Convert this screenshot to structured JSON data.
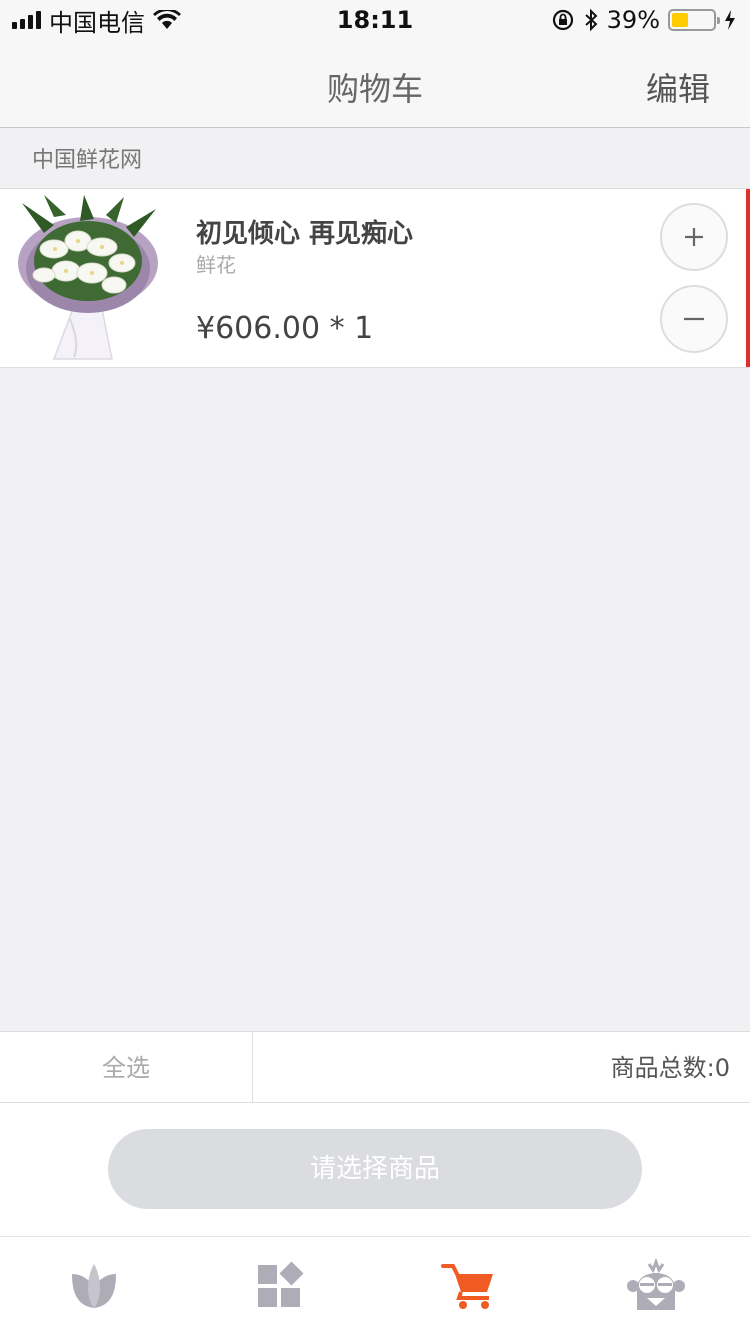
{
  "status_bar": {
    "carrier": "中国电信",
    "time": "18:11",
    "battery_percent": "39%",
    "battery_level": 0.39,
    "icons": [
      "signal-icon",
      "wifi-icon",
      "orientation-lock-icon",
      "bluetooth-icon",
      "battery-icon",
      "charging-icon"
    ]
  },
  "nav": {
    "title": "购物车",
    "edit_label": "编辑"
  },
  "shop": {
    "name": "中国鲜花网"
  },
  "cart_items": [
    {
      "name": "初见倾心 再见痴心",
      "category": "鲜花",
      "price_line": "¥606.00 * 1"
    }
  ],
  "summary": {
    "select_all_label": "全选",
    "total_label": "商品总数:0"
  },
  "checkout": {
    "button_label": "请选择商品"
  },
  "tabs": [
    {
      "icon": "leaf-icon",
      "active": false
    },
    {
      "icon": "category-icon",
      "active": false
    },
    {
      "icon": "cart-icon",
      "active": true
    },
    {
      "icon": "profile-monkey-icon",
      "active": false
    }
  ],
  "colors": {
    "accent": "#f05a23",
    "inactive_icon": "#aeadb7",
    "item_marker": "#e0302d",
    "disabled_button": "#dbdcdf"
  }
}
